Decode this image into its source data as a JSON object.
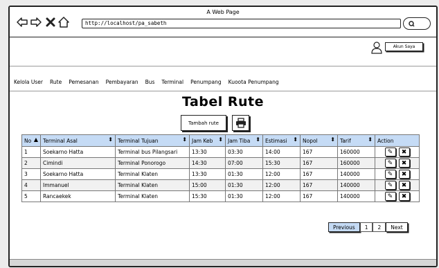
{
  "window": {
    "title": "A Web Page"
  },
  "browser": {
    "url": "http://localhost/pa_sabeth"
  },
  "header": {
    "account_button": "Akun Saya"
  },
  "menu": [
    "Kelola User",
    "Rute",
    "Pemesanan",
    "Pembayaran",
    "Bus",
    "Terminal",
    "Penumpang",
    "Kuoota Penumpang"
  ],
  "page": {
    "title": "Tabel Rute",
    "add_button": "Tambah rute"
  },
  "table": {
    "headers": [
      "No",
      "Terminal Asal",
      "Terminal Tujuan",
      "Jam Keb",
      "Jam Tiba",
      "Estimasi",
      "Nopol",
      "Tarif",
      "Action"
    ],
    "rows": [
      [
        "1",
        "Soekarno Hatta",
        "Terminal bus Pilangsari",
        "13:30",
        "03:30",
        "14:00",
        "167",
        "160000"
      ],
      [
        "2",
        "Cimindi",
        "Terminal Ponorogo",
        "14:30",
        "07:00",
        "15:30",
        "167",
        "160000"
      ],
      [
        "3",
        "Soekarno Hatta",
        "Terminal Klaten",
        "13:30",
        "01:30",
        "12:00",
        "167",
        "140000"
      ],
      [
        "4",
        "Immanuel",
        "Terminal Klaten",
        "15:00",
        "01:30",
        "12:00",
        "167",
        "140000"
      ],
      [
        "5",
        "Rancaekek",
        "Terminal Klaten",
        "15:30",
        "01:30",
        "12:00",
        "167",
        "140000"
      ]
    ]
  },
  "pagination": {
    "previous": "Previous",
    "pages": [
      "1",
      "2"
    ],
    "next": "Next"
  }
}
